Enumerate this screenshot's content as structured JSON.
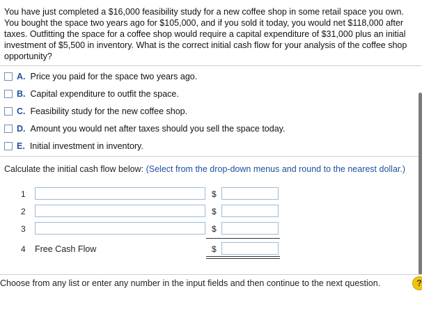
{
  "question": {
    "text": "You have just completed a $16,000 feasibility study for a new coffee shop in some retail space you own. You bought the space two years ago for $105,000, and if you sold it today, you would net $118,000 after taxes. Outfitting the space for a coffee shop would require a capital expenditure of $31,000 plus an initial investment of $5,500 in inventory. What is the correct initial cash flow for your analysis of the coffee shop opportunity?"
  },
  "options": [
    {
      "letter": "A.",
      "text": "Price you paid for the space two years ago."
    },
    {
      "letter": "B.",
      "text": "Capital expenditure to outfit the space."
    },
    {
      "letter": "C.",
      "text": "Feasibility study for the new coffee shop."
    },
    {
      "letter": "D.",
      "text": "Amount you would net after taxes should you sell the space today."
    },
    {
      "letter": "E.",
      "text": "Initial investment in inventory."
    }
  ],
  "instructions": {
    "lead": "Calculate the initial cash flow below:",
    "note": "(Select from the drop-down menus and round to the nearest dollar.)"
  },
  "cash_flow_table": {
    "rows": [
      {
        "num": "1",
        "label_value": "",
        "currency": "$",
        "amount": ""
      },
      {
        "num": "2",
        "label_value": "",
        "currency": "$",
        "amount": ""
      },
      {
        "num": "3",
        "label_value": "",
        "currency": "$",
        "amount": ""
      }
    ],
    "total": {
      "num": "4",
      "label": "Free Cash Flow",
      "currency": "$",
      "amount": ""
    }
  },
  "footer": {
    "text": "Choose from any list or enter any number in the input fields and then continue to the next question.",
    "help_symbol": "?"
  },
  "colors": {
    "accent": "#1f4f9c",
    "input_border": "#9bbbd8",
    "help": "#f1c40f"
  }
}
